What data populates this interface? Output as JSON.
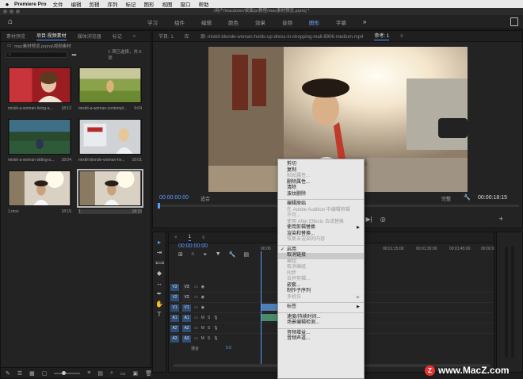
{
  "menubar": {
    "app_name": "Premiere Pro",
    "items": [
      "文件",
      "编辑",
      "剪辑",
      "序列",
      "标记",
      "图形",
      "视图",
      "窗口",
      "帮助"
    ]
  },
  "window_title": "/用户/macdown/桌面/pr教程/mac素材预览.prproj *",
  "workspaces": {
    "tabs": [
      "学习",
      "组件",
      "编辑",
      "颜色",
      "效果",
      "音频",
      "图形",
      "字幕"
    ],
    "active": 6
  },
  "project_panel": {
    "tabs": [
      "素材预览",
      "项目:视频素材",
      "媒体浏览器",
      "标记"
    ],
    "active_tab": 1,
    "path": "mac素材预览.prproj\\视频素材",
    "search_placeholder": "",
    "status": "1 项已选择，共 6 项",
    "items": [
      {
        "name": "mixkit-a-woman-living-a...",
        "duration": "18:12"
      },
      {
        "name": "mixkit-a-woman-contempl...",
        "duration": "9:04"
      },
      {
        "name": "mixkit-a-woman-sitting-a...",
        "duration": "18:04"
      },
      {
        "name": "mixkit-blonde-woman-ho...",
        "duration": "10:01"
      },
      {
        "name": "1.mov",
        "duration": "18:15"
      },
      {
        "name": "1",
        "duration": "18:15"
      }
    ]
  },
  "program_monitor": {
    "tabs": [
      "节目: 1",
      "库",
      "源: mixkit-blonde-woman-holds-up-dress-in-shopping-mall-8906-medium.mp4",
      "参考: 1"
    ],
    "active_tab": 3,
    "timecode_current": "00:00:00:00",
    "fit": "适合",
    "quality": "完整",
    "timecode_duration": "00:00:18:15"
  },
  "timeline": {
    "sequence_tab": "1",
    "timecode": "00:00:00:00",
    "ruler_labels": [
      "00:00",
      "00:01:15:00",
      "00:01:30:00",
      "00:01:45:00",
      "00:02:0"
    ],
    "video_tracks": [
      "V3",
      "V2",
      "V1"
    ],
    "audio_tracks": [
      "A1",
      "A2",
      "A3"
    ],
    "master_label": "混合",
    "master_value": "0.0"
  },
  "context_menu": {
    "items": [
      {
        "label": "剪切",
        "disabled": false
      },
      {
        "label": "复制",
        "disabled": false
      },
      {
        "label": "粘贴属性...",
        "disabled": true
      },
      {
        "label": "删除属性...",
        "disabled": false
      },
      {
        "label": "清除",
        "disabled": false
      },
      {
        "label": "波纹删除",
        "disabled": false
      },
      {
        "sep": true
      },
      {
        "label": "编辑原始",
        "disabled": false
      },
      {
        "label": "在 Adobe Audition 中编辑剪辑",
        "disabled": true
      },
      {
        "label": "许可...",
        "disabled": true
      },
      {
        "label": "使用 After Effects 合成替换",
        "disabled": true
      },
      {
        "label": "使用剪辑替换",
        "disabled": false,
        "submenu": true
      },
      {
        "label": "渲染和替换...",
        "disabled": false
      },
      {
        "label": "恢复未渲染的内容",
        "disabled": true
      },
      {
        "sep": true
      },
      {
        "label": "启用",
        "disabled": false,
        "checked": true
      },
      {
        "label": "取消链接",
        "disabled": false,
        "highlight": true
      },
      {
        "label": "编组",
        "disabled": true
      },
      {
        "label": "取消编组",
        "disabled": true
      },
      {
        "label": "同步",
        "disabled": true
      },
      {
        "label": "合并剪辑...",
        "disabled": true
      },
      {
        "label": "嵌套...",
        "disabled": false
      },
      {
        "label": "制作子序列",
        "disabled": false
      },
      {
        "label": "多机位",
        "disabled": true,
        "submenu": true
      },
      {
        "sep": true
      },
      {
        "label": "标签",
        "disabled": false,
        "submenu": true
      },
      {
        "sep": true
      },
      {
        "label": "速度/持续时间...",
        "disabled": false
      },
      {
        "label": "场景编辑检测...",
        "disabled": false
      },
      {
        "sep": true
      },
      {
        "label": "音频增益...",
        "disabled": false
      },
      {
        "label": "音频声道...",
        "disabled": false
      }
    ]
  },
  "watermark": "www.MacZ.com",
  "colors": {
    "accent": "#5a9bff",
    "track_label": "#2e4e75"
  }
}
